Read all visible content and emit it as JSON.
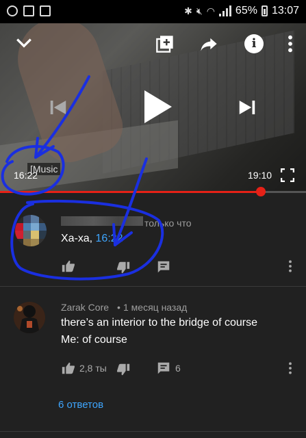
{
  "status_bar": {
    "battery": "65%",
    "time": "13:07"
  },
  "player": {
    "caption": "[Music",
    "current_time": "16:22",
    "duration": "19:10",
    "progress_fraction": 0.852,
    "progress_color": "#e62117"
  },
  "comments": [
    {
      "author": "",
      "age": "только что",
      "text_prefix": "Ха-ха, ",
      "timestamp_link": "16:22",
      "likes": "",
      "replies_count": ""
    },
    {
      "author": "Zarak Core",
      "age": "1 месяц назад",
      "line1": "there’s an interior to the bridge of course",
      "line2": "Me: of course",
      "likes": "2,8 ты",
      "replies_count": "6",
      "replies_link": "6 ответов"
    }
  ],
  "icons": [
    "collapse-chevron-icon",
    "add-to-playlist-icon",
    "share-icon",
    "info-icon",
    "more-vert-icon",
    "previous-icon",
    "play-icon",
    "next-icon",
    "fullscreen-icon",
    "like-icon",
    "dislike-icon",
    "reply-icon"
  ],
  "colors": {
    "link": "#3ea6ff",
    "background": "#212121",
    "annotation": "#1a2fe0"
  }
}
